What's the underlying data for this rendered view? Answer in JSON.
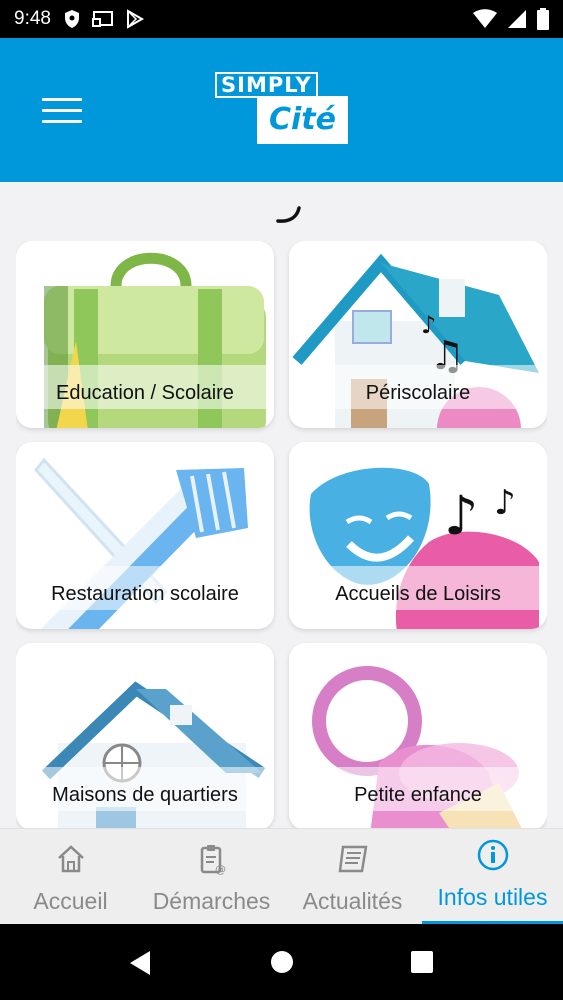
{
  "status_bar": {
    "time": "9:48",
    "left_icons": [
      "shield-icon",
      "cast-icon",
      "play-store-icon"
    ],
    "right_icons": [
      "wifi-icon",
      "signal-icon",
      "battery-icon"
    ]
  },
  "header": {
    "logo_line1": "SIMPLY",
    "logo_line2": "Cité",
    "menu_icon": "hamburger-menu-icon",
    "color": "#0098da"
  },
  "categories": [
    {
      "label": "Education / Scolaire",
      "icon": "school-bag-icon"
    },
    {
      "label": "Périscolaire",
      "icon": "house-music-icon"
    },
    {
      "label": "Restauration scolaire",
      "icon": "knife-fork-icon"
    },
    {
      "label": "Accueils de Loisirs",
      "icon": "theater-masks-icon"
    },
    {
      "label": "Maisons de quartiers",
      "icon": "house-icon"
    },
    {
      "label": "Petite enfance",
      "icon": "pacifier-icon"
    }
  ],
  "bottom_nav": {
    "items": [
      {
        "label": "Accueil",
        "icon": "home-icon",
        "active": false
      },
      {
        "label": "Démarches",
        "icon": "clipboard-icon",
        "active": false
      },
      {
        "label": "Actualités",
        "icon": "newspaper-icon",
        "active": false
      },
      {
        "label": "Infos utiles",
        "icon": "info-icon",
        "active": true
      }
    ],
    "active_color": "#0098da",
    "inactive_color": "#8a8a8a"
  },
  "android_nav": [
    "back-icon",
    "home-circle-icon",
    "recents-icon"
  ]
}
